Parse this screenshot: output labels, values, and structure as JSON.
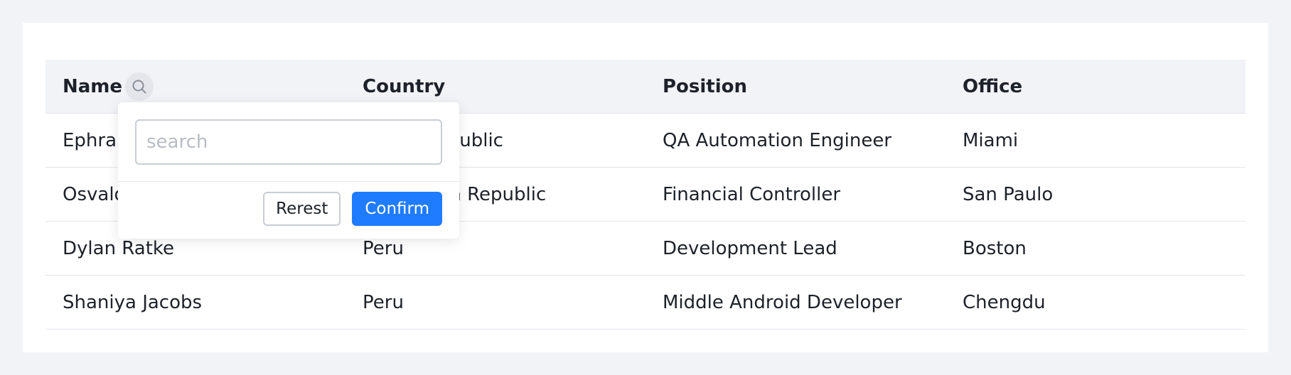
{
  "table": {
    "columns": [
      "Name",
      "Country",
      "Position",
      "Office"
    ],
    "rows": [
      [
        "Ephraim Stokes",
        "Czech Republic",
        "QA Automation Engineer",
        "Miami"
      ],
      [
        "Osvaldo Schulist",
        "Dominican Republic",
        "Financial Controller",
        "San Paulo"
      ],
      [
        "Dylan Ratke",
        "Peru",
        "Development Lead",
        "Boston"
      ],
      [
        "Shaniya Jacobs",
        "Peru",
        "Middle Android Developer",
        "Chengdu"
      ]
    ]
  },
  "filter": {
    "icon": "search-icon",
    "placeholder": "search",
    "value": "",
    "reset_label": "Rerest",
    "confirm_label": "Confirm"
  },
  "colors": {
    "accent": "#1f7cff",
    "header_bg": "#f2f3f7",
    "page_bg": "#f2f3f7"
  }
}
